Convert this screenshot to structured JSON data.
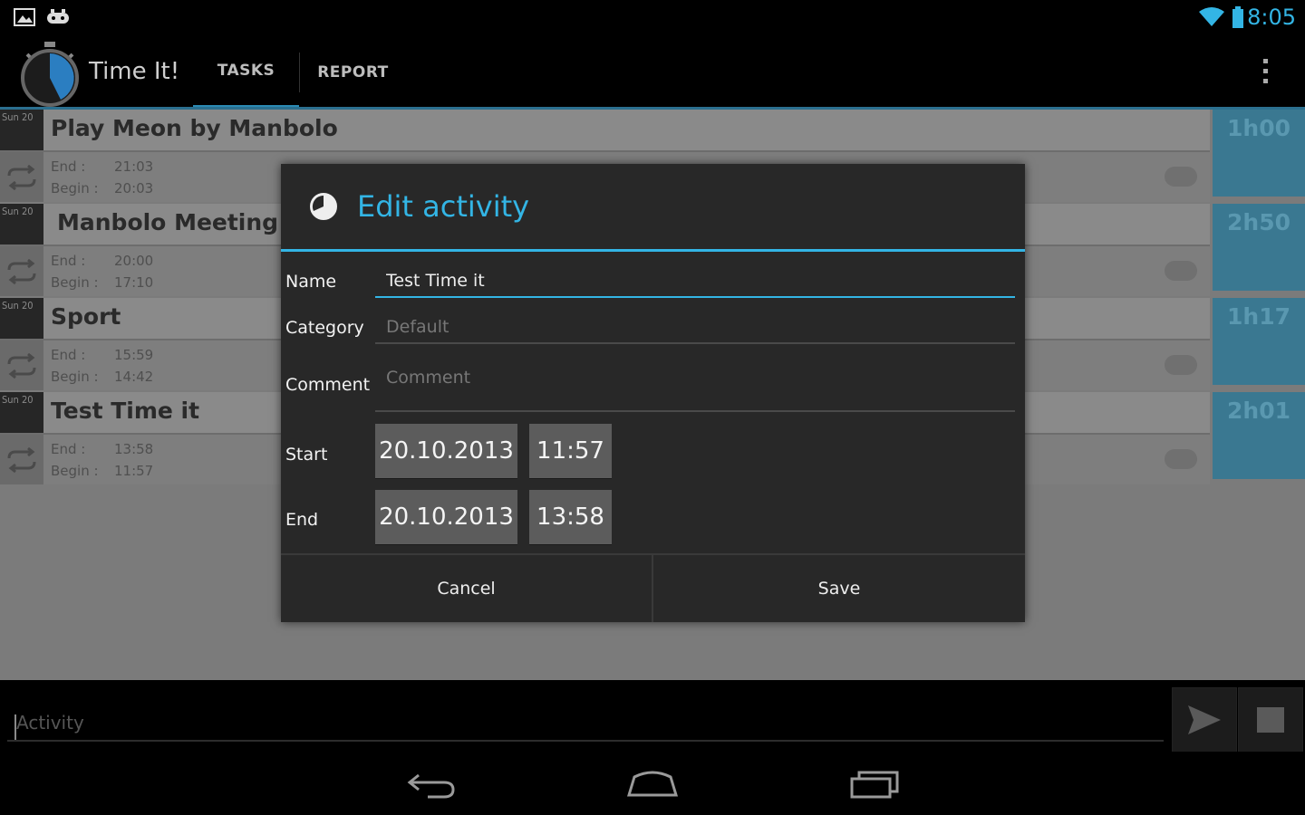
{
  "status_bar": {
    "time": "8:05"
  },
  "action_bar": {
    "app_title": "Time It!",
    "tabs": [
      {
        "label": "TASKS",
        "selected": true
      },
      {
        "label": "REPORT",
        "selected": false
      }
    ]
  },
  "tasks": [
    {
      "date": "Sun 20",
      "name": "Play Meon by Manbolo",
      "end_label": "End :",
      "end": "21:03",
      "begin_label": "Begin :",
      "begin": "20:03",
      "duration": "1h00"
    },
    {
      "date": "Sun 20",
      "name": "Manbolo Meeting",
      "end_label": "End :",
      "end": "20:00",
      "begin_label": "Begin :",
      "begin": "17:10",
      "duration": "2h50"
    },
    {
      "date": "Sun 20",
      "name": "Sport",
      "end_label": "End :",
      "end": "15:59",
      "begin_label": "Begin :",
      "begin": "14:42",
      "duration": "1h17"
    },
    {
      "date": "Sun 20",
      "name": "Test Time it",
      "end_label": "End :",
      "end": "13:58",
      "begin_label": "Begin :",
      "begin": "11:57",
      "duration": "2h01"
    }
  ],
  "dialog": {
    "title": "Edit activity",
    "name_label": "Name",
    "name_value": "Test Time it",
    "category_label": "Category",
    "category_placeholder": "Default",
    "comment_label": "Comment",
    "comment_placeholder": "Comment",
    "start_label": "Start",
    "start_date": "20.10.2013",
    "start_time": "11:57",
    "end_label": "End",
    "end_date": "20.10.2013",
    "end_time": "13:58",
    "cancel_label": "Cancel",
    "save_label": "Save"
  },
  "input_bar": {
    "placeholder": "Activity"
  },
  "colors": {
    "accent": "#33b5e5",
    "duration_bg": "#3a7891"
  }
}
